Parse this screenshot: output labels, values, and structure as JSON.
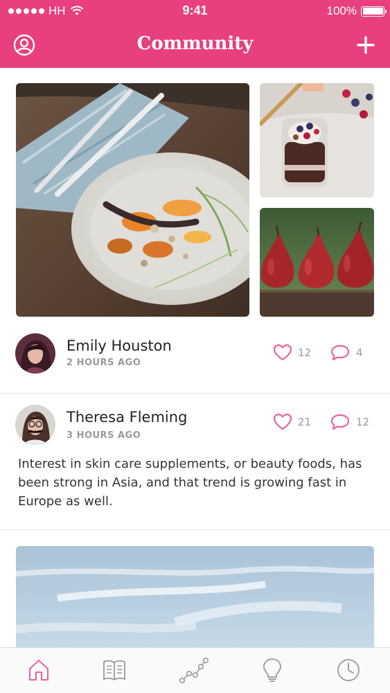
{
  "status_bar": {
    "carrier": "HH",
    "time": "9:41",
    "battery": "100%"
  },
  "header": {
    "title": "Community",
    "left_icon": "profile-icon",
    "right_icon": "plus-icon",
    "accent_color": "#e8407f"
  },
  "gallery": {
    "images": [
      {
        "name": "carrots-dish-photo"
      },
      {
        "name": "berry-parfait-photo"
      },
      {
        "name": "pears-photo"
      }
    ]
  },
  "posts": [
    {
      "author": "Emily Houston",
      "time_ago": "2 HOURS AGO",
      "likes": "12",
      "comments": "4"
    },
    {
      "author": "Theresa Fleming",
      "time_ago": "3 HOURS AGO",
      "likes": "21",
      "comments": "12",
      "text": "Interest in skin care supplements, or beauty foods, has been strong in Asia, and that trend is growing fast in Europe as well."
    }
  ],
  "tab_bar": {
    "tabs": [
      {
        "icon": "home-icon",
        "active": true
      },
      {
        "icon": "book-icon",
        "active": false
      },
      {
        "icon": "chart-path-icon",
        "active": false
      },
      {
        "icon": "lightbulb-icon",
        "active": false
      },
      {
        "icon": "clock-icon",
        "active": false
      }
    ]
  }
}
